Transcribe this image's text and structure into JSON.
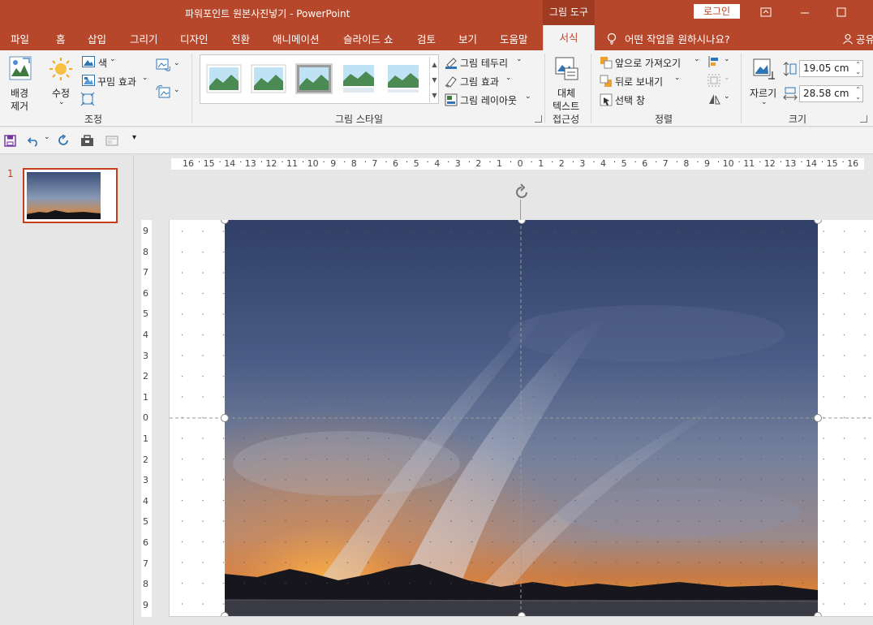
{
  "window": {
    "title": "파워포인트 원본사진넣기  -  PowerPoint",
    "context_tab": "그림 도구",
    "signin": "로그인"
  },
  "tabs": [
    {
      "label": "파일"
    },
    {
      "label": "홈"
    },
    {
      "label": "삽입"
    },
    {
      "label": "그리기"
    },
    {
      "label": "디자인"
    },
    {
      "label": "전환"
    },
    {
      "label": "애니메이션"
    },
    {
      "label": "슬라이드 쇼"
    },
    {
      "label": "검토"
    },
    {
      "label": "보기"
    },
    {
      "label": "도움말"
    },
    {
      "label": "서식"
    }
  ],
  "tell_me": "어떤 작업을 원하시나요?",
  "share": "공유",
  "ribbon": {
    "remove_bg": {
      "line1": "배경",
      "line2": "제거"
    },
    "corrections": "수정",
    "color": "색",
    "artistic": "꾸밈 효과",
    "adjust_group": "조정",
    "picture_border": "그림 테두리",
    "picture_effects": "그림 효과",
    "picture_layout": "그림 레이아웃",
    "styles_group": "그림 스타일",
    "alt_text": {
      "line1": "대체",
      "line2": "텍스트"
    },
    "accessibility_group": "접근성",
    "bring_forward": "앞으로 가져오기",
    "send_backward": "뒤로 보내기",
    "selection_pane": "선택 창",
    "arrange_group": "정렬",
    "crop": "자르기",
    "height": "19.05 cm",
    "width": "28.58 cm",
    "size_group": "크기"
  },
  "slides": [
    {
      "number": "1"
    }
  ],
  "ruler": {
    "horizontal": [
      "16",
      "15",
      "14",
      "13",
      "12",
      "11",
      "10",
      "9",
      "8",
      "7",
      "6",
      "5",
      "4",
      "3",
      "2",
      "1",
      "0",
      "1",
      "2",
      "3",
      "4",
      "5",
      "6",
      "7",
      "8",
      "9",
      "10",
      "11",
      "12",
      "13",
      "14",
      "15",
      "16"
    ],
    "vertical": [
      "9",
      "8",
      "7",
      "6",
      "5",
      "4",
      "3",
      "2",
      "1",
      "0",
      "1",
      "2",
      "3",
      "4",
      "5",
      "6",
      "7",
      "8",
      "9"
    ]
  },
  "colors": {
    "accent": "#b7472a",
    "accent_dark": "#9e3b22",
    "ribbon_bg": "#f3f3f3",
    "workspace": "#e6e6e6"
  }
}
